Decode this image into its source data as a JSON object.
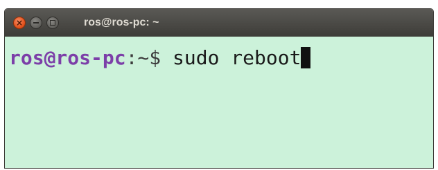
{
  "window": {
    "title": "ros@ros-pc: ~"
  },
  "titlebar": {
    "close_glyph": "×",
    "buttons": [
      "close-icon",
      "minimize-icon",
      "maximize-icon"
    ]
  },
  "terminal": {
    "prompt_user": "ros@ros-pc",
    "prompt_path": ":~$ ",
    "command": "sudo reboot",
    "colors": {
      "background": "#ccf2da",
      "prompt": "#7c3fa8",
      "text": "#1a1a1a"
    }
  }
}
